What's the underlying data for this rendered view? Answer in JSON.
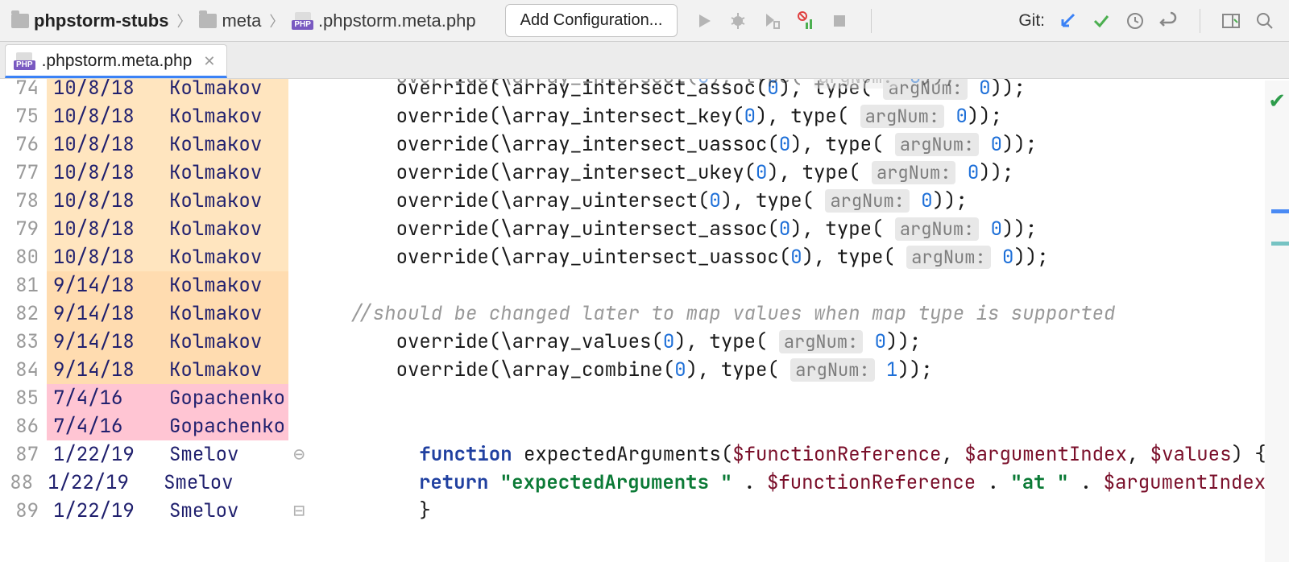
{
  "breadcrumb": {
    "root": "phpstorm-stubs",
    "mid": "meta",
    "file": ".phpstorm.meta.php"
  },
  "toolbar": {
    "config_btn": "Add Configuration...",
    "git_label": "Git:"
  },
  "tab": {
    "title": ".phpstorm.meta.php"
  },
  "blame_lines": [
    {
      "num": "74",
      "date": "10/8/18",
      "author": "Kolmakov",
      "cls": "blame-a"
    },
    {
      "num": "75",
      "date": "10/8/18",
      "author": "Kolmakov",
      "cls": "blame-a"
    },
    {
      "num": "76",
      "date": "10/8/18",
      "author": "Kolmakov",
      "cls": "blame-a"
    },
    {
      "num": "77",
      "date": "10/8/18",
      "author": "Kolmakov",
      "cls": "blame-a"
    },
    {
      "num": "78",
      "date": "10/8/18",
      "author": "Kolmakov",
      "cls": "blame-a"
    },
    {
      "num": "79",
      "date": "10/8/18",
      "author": "Kolmakov",
      "cls": "blame-a"
    },
    {
      "num": "80",
      "date": "10/8/18",
      "author": "Kolmakov",
      "cls": "blame-a"
    },
    {
      "num": "81",
      "date": "9/14/18",
      "author": "Kolmakov",
      "cls": "blame-b"
    },
    {
      "num": "82",
      "date": "9/14/18",
      "author": "Kolmakov",
      "cls": "blame-b"
    },
    {
      "num": "83",
      "date": "9/14/18",
      "author": "Kolmakov",
      "cls": "blame-b"
    },
    {
      "num": "84",
      "date": "9/14/18",
      "author": "Kolmakov",
      "cls": "blame-b"
    },
    {
      "num": "85",
      "date": "7/4/16",
      "author": "Gopachenko",
      "cls": "blame-c"
    },
    {
      "num": "86",
      "date": "7/4/16",
      "author": "Gopachenko",
      "cls": "blame-c"
    },
    {
      "num": "87",
      "date": "1/22/19",
      "author": "Smelov",
      "cls": "blame-d"
    },
    {
      "num": "88",
      "date": "1/22/19",
      "author": "Smelov",
      "cls": "blame-d"
    },
    {
      "num": "89",
      "date": "1/22/19",
      "author": "Smelov",
      "cls": "blame-d"
    }
  ],
  "code": {
    "l74": {
      "fn": "\\array_intersect_assoc",
      "arg": "0",
      "hint": "argNum:",
      "hval": "0"
    },
    "l75": {
      "fn": "\\array_intersect_key",
      "arg": "0",
      "hint": "argNum:",
      "hval": "0"
    },
    "l76": {
      "fn": "\\array_intersect_uassoc",
      "arg": "0",
      "hint": "argNum:",
      "hval": "0"
    },
    "l77": {
      "fn": "\\array_intersect_ukey",
      "arg": "0",
      "hint": "argNum:",
      "hval": "0"
    },
    "l78": {
      "fn": "\\array_uintersect",
      "arg": "0",
      "hint": "argNum:",
      "hval": "0"
    },
    "l79": {
      "fn": "\\array_uintersect_assoc",
      "arg": "0",
      "hint": "argNum:",
      "hval": "0"
    },
    "l80": {
      "fn": "\\array_uintersect_uassoc",
      "arg": "0",
      "hint": "argNum:",
      "hval": "0"
    },
    "l82": "//should be changed later to map values when map type is supported",
    "l83": {
      "fn": "\\array_values",
      "arg": "0",
      "hint": "argNum:",
      "hval": "0"
    },
    "l84": {
      "fn": "\\array_combine",
      "arg": "0",
      "hint": "argNum:",
      "hval": "1"
    },
    "l87_kw": "function",
    "l87_name": "expectedArguments",
    "l87_p1": "$functionReference",
    "l87_p2": "$argumentIndex",
    "l87_p3": "$values",
    "l88_kw": "return",
    "l88_s1": "\"expectedArguments \"",
    "l88_s2": "\"at \"",
    "l88_v1": "$functionReference",
    "l88_v2": "$argumentIndex",
    "l89": "}"
  }
}
